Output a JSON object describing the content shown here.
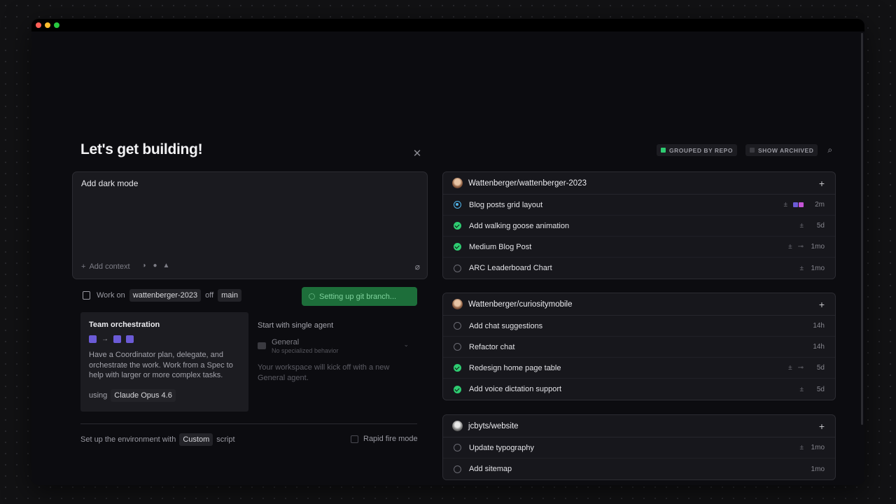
{
  "composer": {
    "title": "Let's get building!",
    "input_value": "Add dark mode",
    "add_context_label": "Add context"
  },
  "workspace": {
    "work_on_label": "Work on",
    "repo": "wattenberger-2023",
    "off_label": "off",
    "branch": "main",
    "git_status": "Setting up git branch..."
  },
  "team": {
    "title": "Team orchestration",
    "description": "Have a Coordinator plan, delegate, and orchestrate the work. Work from a Spec to help with larger or more complex tasks.",
    "using_label": "using",
    "model": "Claude Opus 4.6"
  },
  "single_agent": {
    "title": "Start with single agent",
    "agent_name": "General",
    "agent_subtitle": "No specialized behavior",
    "description": "Your workspace will kick off with a new General agent."
  },
  "environment": {
    "prefix": "Set up the environment with",
    "script_name": "Custom",
    "suffix": "script",
    "rapid_fire_label": "Rapid fire mode"
  },
  "filters": {
    "grouped_label": "GROUPED BY REPO",
    "grouped_color": "#2ecc71",
    "archived_label": "SHOW ARCHIVED"
  },
  "repos": [
    {
      "name": "Wattenberger/wattenberger-2023",
      "tasks": [
        {
          "title": "Blog posts grid layout",
          "status": "progress",
          "time": "2m"
        },
        {
          "title": "Add walking goose animation",
          "status": "done",
          "time": "5d"
        },
        {
          "title": "Medium Blog Post",
          "status": "done",
          "time": "1mo"
        },
        {
          "title": "ARC Leaderboard Chart",
          "status": "todo",
          "time": "1mo"
        }
      ]
    },
    {
      "name": "Wattenberger/curiositymobile",
      "tasks": [
        {
          "title": "Add chat suggestions",
          "status": "todo",
          "time": "14h"
        },
        {
          "title": "Refactor chat",
          "status": "todo",
          "time": "14h"
        },
        {
          "title": "Redesign home page table",
          "status": "done",
          "time": "5d"
        },
        {
          "title": "Add voice dictation support",
          "status": "done",
          "time": "5d"
        }
      ]
    },
    {
      "name": "jcbyts/website",
      "tasks": [
        {
          "title": "Update typography",
          "status": "todo",
          "time": "1mo"
        },
        {
          "title": "Add sitemap",
          "status": "todo",
          "time": "1mo"
        }
      ]
    }
  ]
}
